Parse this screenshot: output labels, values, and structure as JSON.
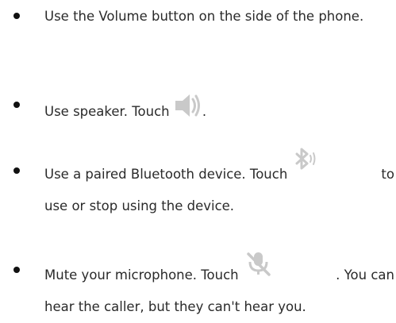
{
  "items": [
    {
      "text": "Use the Volume button on the side of the phone."
    },
    {
      "before": "Use speaker. Touch",
      "icon": "speaker-icon",
      "after": "."
    },
    {
      "before": "Use a paired Bluetooth device. Touch",
      "icon": "bluetooth-audio-icon",
      "after_same_line": "to",
      "after_next_line": "use or stop using the device."
    },
    {
      "before": "Mute your microphone. Touch",
      "icon": "mute-microphone-icon",
      "after_same_line": ". You can",
      "after_next_line": "hear the caller, but they can't hear you."
    }
  ],
  "colors": {
    "text": "#2a2a2a",
    "bullet": "#111111",
    "icon": "#c9c9c9"
  }
}
